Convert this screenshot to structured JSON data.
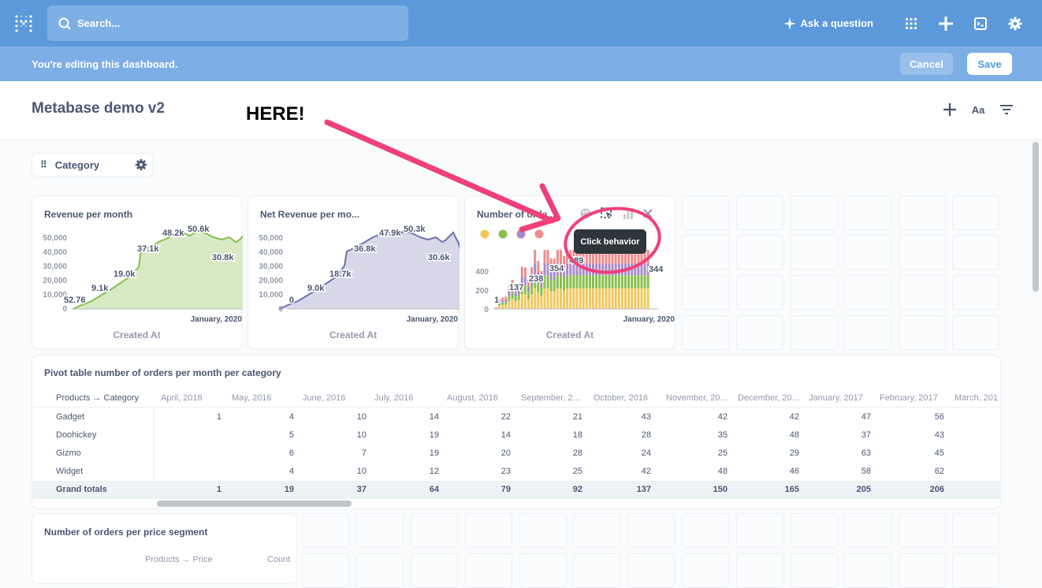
{
  "topnav": {
    "search_placeholder": "Search...",
    "ask_label": "Ask a question"
  },
  "editbar": {
    "message": "You're editing this dashboard.",
    "cancel_label": "Cancel",
    "save_label": "Save"
  },
  "dashboard": {
    "title": "Metabase demo v2",
    "font_label": "Aa"
  },
  "annotation": {
    "text": "HERE!",
    "color": "#f0407a"
  },
  "filter": {
    "label": "Category"
  },
  "cards": [
    {
      "title": "Revenue per month",
      "x_label": "Created At",
      "x_tick": "January, 2020",
      "y_ticks": [
        "50,000",
        "40,000",
        "30,000",
        "20,000",
        "10,000",
        "0"
      ],
      "labels": [
        "52.76",
        "9.1k",
        "19.0k",
        "37.1k",
        "48.2k",
        "50.6k",
        "30.8k"
      ],
      "color": "#88bf4d"
    },
    {
      "title": "Net Revenue per mo...",
      "x_label": "Created At",
      "x_tick": "January, 2020",
      "y_ticks": [
        "50,000",
        "40,000",
        "30,000",
        "20,000",
        "10,000",
        "0"
      ],
      "labels": [
        "0",
        "9.0k",
        "18.7k",
        "36.8k",
        "47.9k",
        "50.3k",
        "30.6k"
      ],
      "color": "#7172ad"
    },
    {
      "title": "Number of orde...",
      "x_label": "Created At",
      "x_tick": "January, 2020",
      "y_ticks": [
        "400",
        "200",
        "0"
      ],
      "labels": [
        "1",
        "137",
        "238",
        "354",
        "489",
        "344"
      ],
      "legend_colors": [
        "#f2c85d",
        "#88bf4d",
        "#a989c5",
        "#ef8c8c"
      ]
    }
  ],
  "tooltip": "Click behavior",
  "pivot": {
    "title": "Pivot table number of orders per month per category",
    "corner": "Products → Category",
    "columns": [
      "April, 2016",
      "May, 2016",
      "June, 2016",
      "July, 2016",
      "August, 2016",
      "September, 2...",
      "October, 2016",
      "November, 20...",
      "December, 20...",
      "January, 2017",
      "February, 2017",
      "March, 201"
    ],
    "rows": [
      {
        "label": "Gadget",
        "values": [
          "1",
          "4",
          "10",
          "14",
          "22",
          "21",
          "43",
          "42",
          "42",
          "47",
          "56"
        ]
      },
      {
        "label": "Doohickey",
        "values": [
          "",
          "5",
          "10",
          "19",
          "14",
          "18",
          "28",
          "35",
          "48",
          "37",
          "43"
        ]
      },
      {
        "label": "Gizmo",
        "values": [
          "",
          "6",
          "7",
          "19",
          "20",
          "28",
          "24",
          "25",
          "29",
          "63",
          "45"
        ]
      },
      {
        "label": "Widget",
        "values": [
          "",
          "4",
          "10",
          "12",
          "23",
          "25",
          "42",
          "48",
          "46",
          "58",
          "62"
        ]
      }
    ],
    "totals": {
      "label": "Grand totals",
      "values": [
        "1",
        "19",
        "37",
        "64",
        "79",
        "92",
        "137",
        "150",
        "165",
        "205",
        "206"
      ]
    }
  },
  "segment": {
    "title": "Number of orders per price segment",
    "col1": "Products → Price",
    "col2": "Count"
  }
}
